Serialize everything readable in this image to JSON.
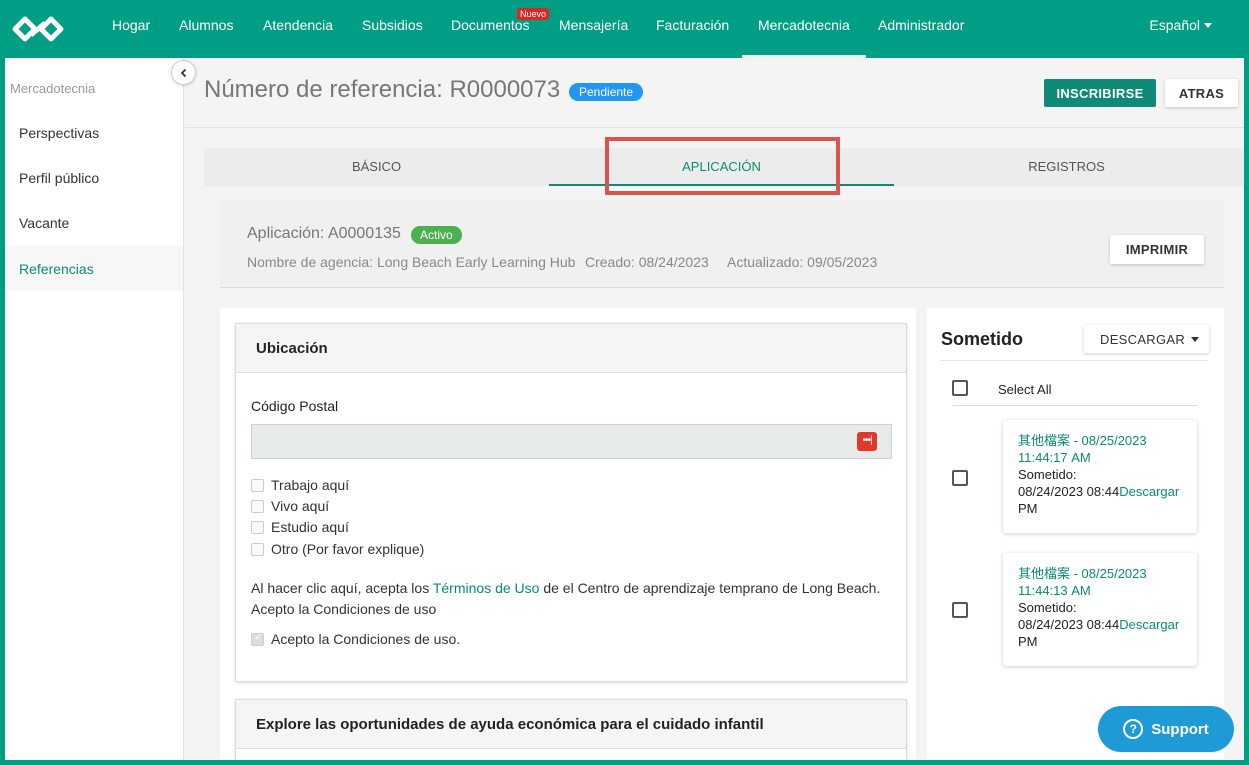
{
  "nav": {
    "items": [
      "Hogar",
      "Alumnos",
      "Atendencia",
      "Subsidios",
      "Documentos",
      "Mensajería",
      "Facturación",
      "Mercadotecnia",
      "Administrador"
    ],
    "new_badge": "Nuevo",
    "active": "Mercadotecnia",
    "language": "Español"
  },
  "sidebar": {
    "title": "Mercadotecnia",
    "items": [
      "Perspectivas",
      "Perfil público",
      "Vacante",
      "Referencias"
    ],
    "active": "Referencias"
  },
  "header": {
    "title": "Número de referencia: R0000073",
    "status": "Pendiente",
    "enroll_label": "INSCRIBIRSE",
    "back_label": "ATRAS"
  },
  "tabs": [
    "BÁSICO",
    "APLICACIÓN",
    "REGISTROS"
  ],
  "active_tab": "APLICACIÓN",
  "application": {
    "title": "Aplicación: A0000135",
    "status": "Activo",
    "agency": "Nombre de agencia: Long Beach Early Learning Hub",
    "created": "Creado: 08/24/2023",
    "updated": "Actualizado: 09/05/2023",
    "print_label": "IMPRIMIR"
  },
  "location": {
    "heading": "Ubicación",
    "postal_label": "Código Postal",
    "postal_value": "",
    "options": [
      {
        "label": "Trabajo aquí",
        "checked": false
      },
      {
        "label": "Vivo aquí",
        "checked": false
      },
      {
        "label": "Estudio aquí",
        "checked": false
      },
      {
        "label": "Otro (Por favor explique)",
        "checked": false
      }
    ],
    "terms_prefix": "Al hacer clic aquí, acepta los ",
    "terms_link": "Términos de Uso",
    "terms_suffix": " de el Centro de aprendizaje temprano de Long Beach.",
    "terms_line2": "Acepto la Condiciones de uso",
    "accept_label": "Acepto la Condiciones de uso."
  },
  "explore_heading": "Explore las oportunidades de ayuda económica para el cuidado infantil",
  "submitted": {
    "title": "Sometido",
    "download_label": "DESCARGAR",
    "select_all": "Select All",
    "files": [
      {
        "name": "其他檔案 - 08/25/2023 11:44:17 AM",
        "submitted_label": "Sometido:",
        "date": "08/24/2023 08:44",
        "ampm": "PM",
        "download": "Descargar"
      },
      {
        "name": "其他檔案 - 08/25/2023 11:44:13 AM",
        "submitted_label": "Sometido:",
        "date": "08/24/2023 08:44",
        "ampm": "PM",
        "download": "Descargar"
      }
    ]
  },
  "support_label": "Support",
  "colors": {
    "brand": "#009e85",
    "accent": "#0a8b75",
    "pending": "#2196f3",
    "active": "#4caf50",
    "highlight": "#d9534f"
  }
}
